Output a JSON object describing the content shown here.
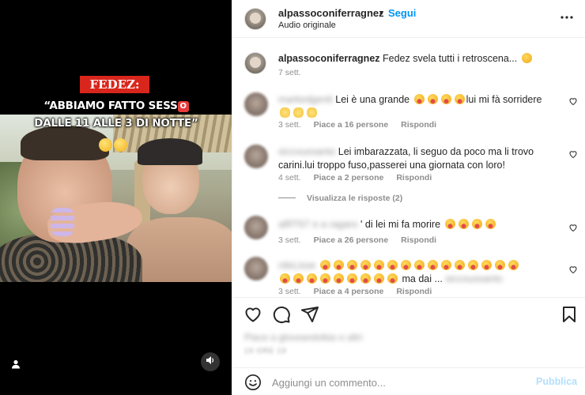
{
  "media": {
    "badge": "FEDEZ:",
    "quote_line1": "“ABBIAMO FATTO SESS",
    "quote_line1_icon": "O",
    "quote_line2": "DALLE 11 ALLE 3 DI NOTTE”",
    "icons": [
      "user-tag-icon",
      "sound-icon"
    ]
  },
  "header": {
    "username": "alpassoconiferragnez",
    "dot": "•",
    "follow_label": "Segui",
    "audio": "Audio originale"
  },
  "caption": {
    "username": "alpassoconiferragnez",
    "text": "Fedez svela tutti i retroscena...",
    "time": "7 sett."
  },
  "comments": [
    {
      "username": "markedgenti",
      "text": "Lei è una grande",
      "text_end": "lui mi fà sorridere",
      "time": "3 sett.",
      "likes": "Piace a 16 persone",
      "reply": "Rispondi"
    },
    {
      "username": "siccoussanto",
      "text": "Lei imbarazzata, li seguo da poco ma li trovo carini.lui troppo fuso,passerei una giornata con loro!",
      "time": "4 sett.",
      "likes": "Piace a 2 persone",
      "reply": "Rispondi"
    },
    {
      "username": "alRT67",
      "text_blur": "e a ragaro",
      "text": "' di lei mi fa morire",
      "time": "3 sett.",
      "likes": "Piace a 26 persone",
      "reply": "Rispondi"
    },
    {
      "username": "rdeLisse",
      "text": "ma dai ...",
      "text_blur": "siccoussanto",
      "time": "3 sett.",
      "likes": "Piace a 4 persone",
      "reply": "Rispondi"
    }
  ],
  "view_replies": "Visualizza le risposte (2)",
  "footer": {
    "likes_blur": "Piace a gloveandollas e altri",
    "date_blur": "19 ORE 19",
    "comment_placeholder": "Aggiungi un commento...",
    "publish_label": "Pubblica"
  },
  "colors": {
    "accent": "#0095f6",
    "publish_disabled": "#b2dffc",
    "badge": "#d9261c"
  }
}
